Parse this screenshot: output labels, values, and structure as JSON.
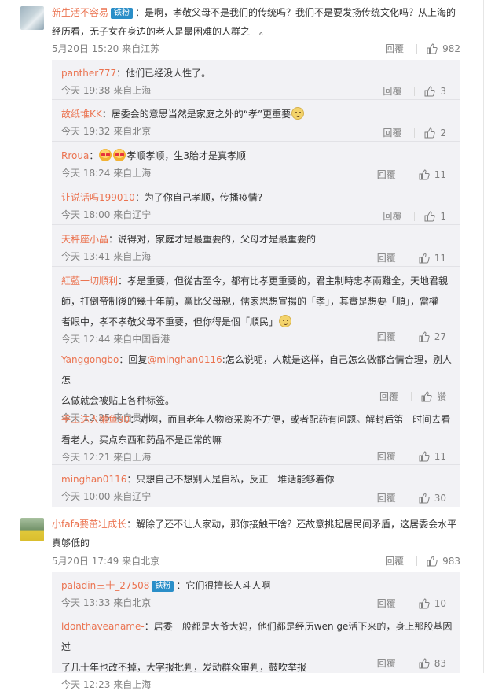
{
  "icons": {
    "like": "thumbs-up-icon",
    "emoji_heart": "heart-eyes-emoji",
    "emoji_face": "cute-face-emoji"
  },
  "colors": {
    "username": "#eb7350",
    "badge_bg": "#2a8ec8",
    "meta": "#808080",
    "reply_bg": "#f2f2f5"
  },
  "comments": [
    {
      "user": "新生活不容易",
      "badge": "铁粉",
      "line1": "：是啊，孝敬父母不是我们的传统吗？我们不是要发扬传统文化吗？从上海的",
      "line2": "经历看，无子女在身边的老人是最困难的人群之一。",
      "meta": "5月20日 15:20 来自江苏",
      "reply_label": "回覆",
      "likes": "982",
      "replies": [
        {
          "user": "panther777",
          "text": "：他们已经没人性了。",
          "meta": "今天 19:38 来自上海",
          "reply_label": "回覆",
          "likes": "3"
        },
        {
          "user": "故纸堆KK",
          "text": "：居委会的意思当然是家庭之外的“孝”更重要",
          "meta": "今天 19:32 来自北京",
          "reply_label": "回覆",
          "likes": "2"
        },
        {
          "user": "Rroua",
          "text_pre": "：",
          "text": "孝顺孝顺，生3胎才是真孝顺",
          "meta": "今天 18:24 来自上海",
          "reply_label": "回覆",
          "likes": "11"
        },
        {
          "user": "让说话吗199010",
          "text": "：为了你自己孝顺，传播疫情?",
          "meta": "今天 18:00 来自辽宁",
          "reply_label": "回覆",
          "likes": "1"
        },
        {
          "user": "天秤座小晶",
          "text": "：说得对，家庭才是最重要的，父母才是最重要的",
          "meta": "今天 13:41 来自上海",
          "reply_label": "回覆",
          "likes": "11"
        },
        {
          "user": "紅藍一切順利",
          "line1": "：孝是重要，但從古至今，都有比孝更重要的，君主制時忠孝兩難全，天地君親",
          "line2": "師，打倒帝制後的幾十年前，黨比父母親，儒家思想宣揚的「孝」，其實是想要「順」，當權",
          "line3": "者眼中，孝不孝敬父母不重要，但你得是個「順民」",
          "meta": "今天 12:44 来自中国香港",
          "reply_label": "回覆",
          "likes": "27"
        },
        {
          "user": "Yanggongbo",
          "line1_pre": "：回复",
          "mention": "@minghan0116",
          "line1": ":怎么说呢，人就是这样，自己怎么做都合情合理，别人怎",
          "line2": "么做就会被贴上各种标签。",
          "meta": "今天 12:25 来自贵州",
          "reply_label": "回覆",
          "likes": "讚"
        },
        {
          "user": "手工达人懒鱼90",
          "line1": "：对啊，而且老年人物资采购不方便，或者配药有问题。解封后第一时间去看",
          "line2": "看老人，买点东西和药品不是正常的嘛",
          "meta": "今天 12:21 来自上海",
          "reply_label": "回覆",
          "likes": "11"
        },
        {
          "user": "minghan0116",
          "text": "：只想自己不想别人是自私，反正一堆话能够着你",
          "meta": "今天 10:00 来自辽宁",
          "reply_label": "回覆",
          "likes": "30"
        }
      ]
    },
    {
      "user": "小fafa要茁壮成长",
      "line1": "：解除了还不让人家动，那你接触干啥？还故意挑起居民间矛盾，这居委会水平",
      "line2": "真够低的",
      "meta": "5月20日 17:49 来自北京",
      "reply_label": "回覆",
      "likes": "983",
      "replies": [
        {
          "user": "paladin三十_27508",
          "badge": "铁粉",
          "text": "：它们很擅长人斗人啊",
          "meta": "今天 13:33 来自北京",
          "reply_label": "回覆",
          "likes": "10"
        },
        {
          "user": "ldonthaveaname-",
          "line1": "：居委一般都是大爷大妈，他们都是经历wen ge活下来的，身上那股基因过",
          "line2": "了几十年也改不掉，大字报批判，发动群众审判，鼓吹举报",
          "meta": "今天 12:23 来自上海",
          "reply_label": "回覆",
          "likes": "83"
        }
      ]
    }
  ]
}
